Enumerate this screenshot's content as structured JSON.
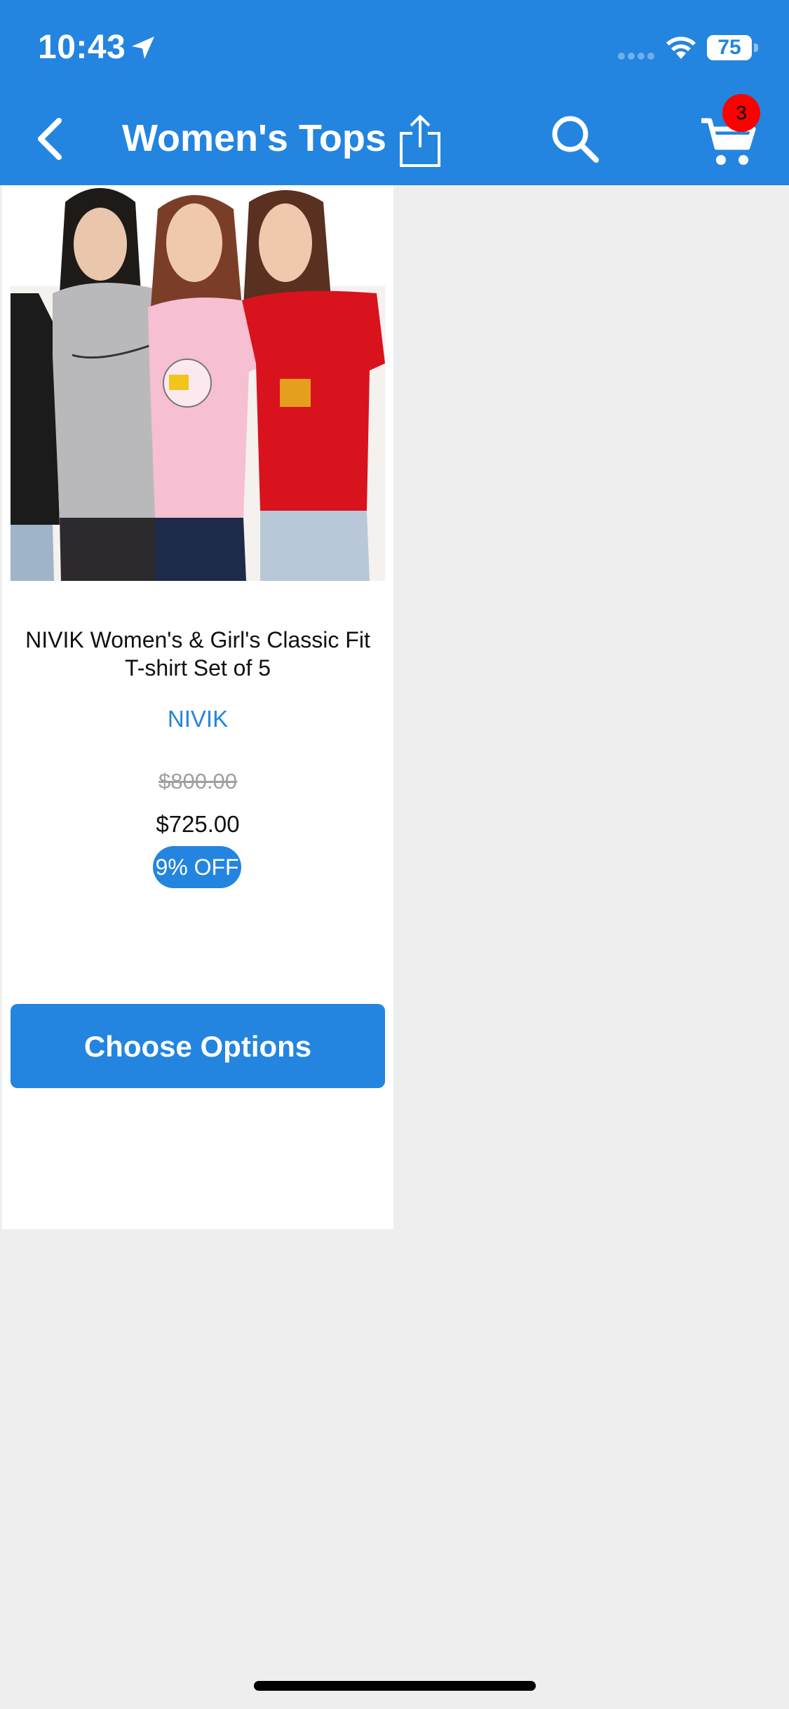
{
  "status_bar": {
    "time": "10:43",
    "battery": "75",
    "icons": [
      "location-arrow-icon",
      "signal-icon",
      "wifi-icon",
      "battery-icon"
    ]
  },
  "nav": {
    "title": "Women's Tops",
    "cart_count": "3",
    "icons": [
      "back-chevron-icon",
      "share-icon",
      "search-icon",
      "cart-icon"
    ]
  },
  "product": {
    "name": "NIVIK Women's & Girl's Classic Fit T-shirt Set of 5",
    "brand": "NIVIK",
    "old_price": "$800.00",
    "price": "$725.00",
    "discount": "9% OFF",
    "cta": "Choose Options"
  },
  "colors": {
    "primary": "#2385df",
    "badge_red": "#ff0000",
    "background": "#eeeeee"
  }
}
